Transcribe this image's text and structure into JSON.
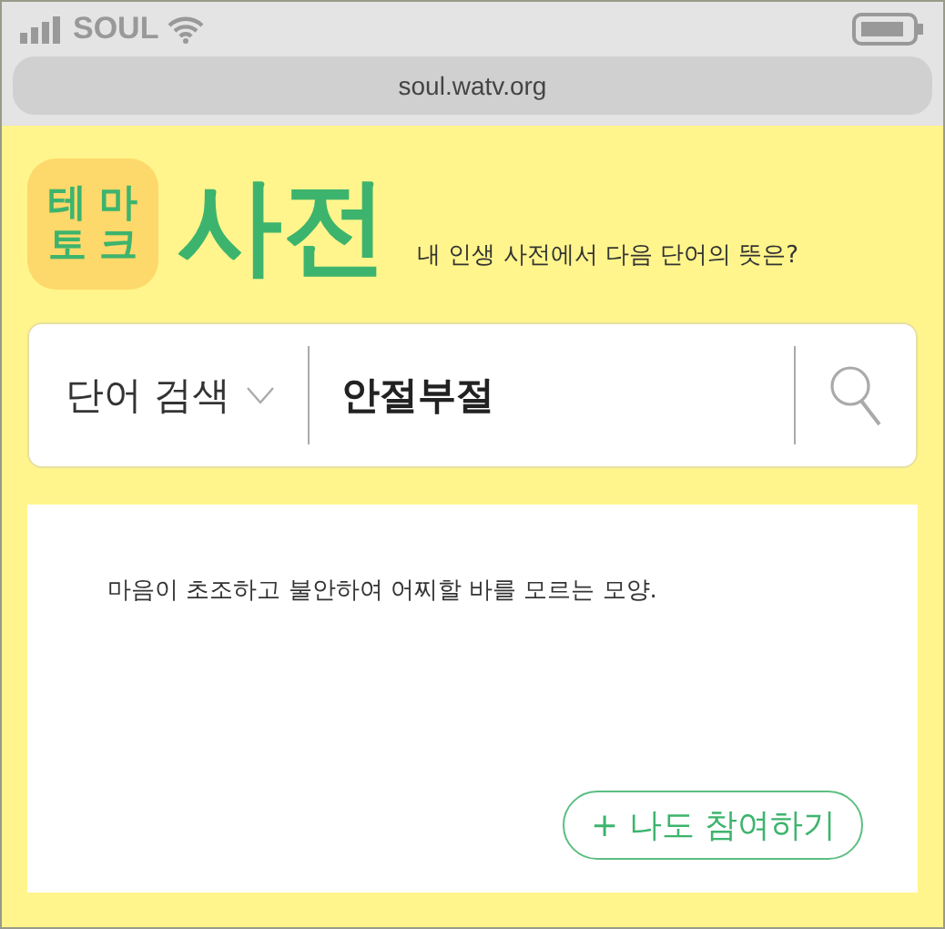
{
  "status_bar": {
    "carrier": "SOUL"
  },
  "address_bar": {
    "url": "soul.watv.org"
  },
  "header": {
    "logo_lines": [
      "테 마",
      "토 크"
    ],
    "title": "사전",
    "subtitle": "내 인생 사전에서 다음 단어의 뜻은?"
  },
  "search": {
    "category": "단어 검색",
    "value": "안절부절"
  },
  "definition": {
    "text": "마음이 초조하고 불안하여 어찌할 바를 모르는 모양.",
    "button": "+ 나도 참여하기"
  }
}
